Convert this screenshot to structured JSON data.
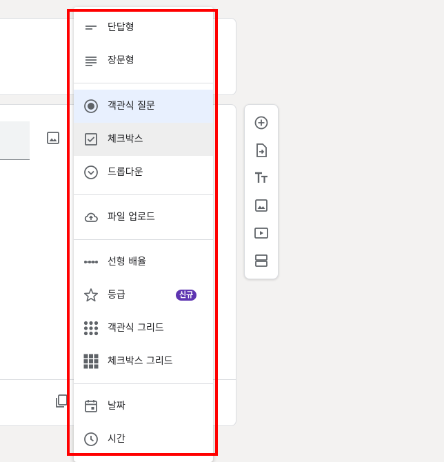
{
  "menu": {
    "items": [
      {
        "label": "단답형",
        "icon": "short-answer-icon"
      },
      {
        "label": "장문형",
        "icon": "paragraph-icon"
      },
      {
        "label": "객관식 질문",
        "icon": "radio-button-icon"
      },
      {
        "label": "체크박스",
        "icon": "checkbox-icon"
      },
      {
        "label": "드롭다운",
        "icon": "dropdown-circle-icon"
      },
      {
        "label": "파일 업로드",
        "icon": "cloud-upload-icon"
      },
      {
        "label": "선형 배율",
        "icon": "linear-scale-icon"
      },
      {
        "label": "등급",
        "icon": "star-icon",
        "badge": "신규"
      },
      {
        "label": "객관식 그리드",
        "icon": "dot-grid-icon"
      },
      {
        "label": "체크박스 그리드",
        "icon": "square-grid-icon"
      },
      {
        "label": "날짜",
        "icon": "calendar-icon"
      },
      {
        "label": "시간",
        "icon": "clock-icon"
      }
    ],
    "selected": "객관식 질문",
    "hovered": "체크박스"
  },
  "toolbar": {
    "buttons": [
      "add-question-icon",
      "import-questions-icon",
      "add-title-icon",
      "add-image-icon",
      "add-video-icon",
      "add-section-icon"
    ]
  },
  "colors": {
    "highlight": "#ff0000",
    "selected_bg": "#e8f0fe",
    "hover_bg": "#eeeeee",
    "badge_bg": "#5e35b1",
    "icon": "#5f6368"
  }
}
